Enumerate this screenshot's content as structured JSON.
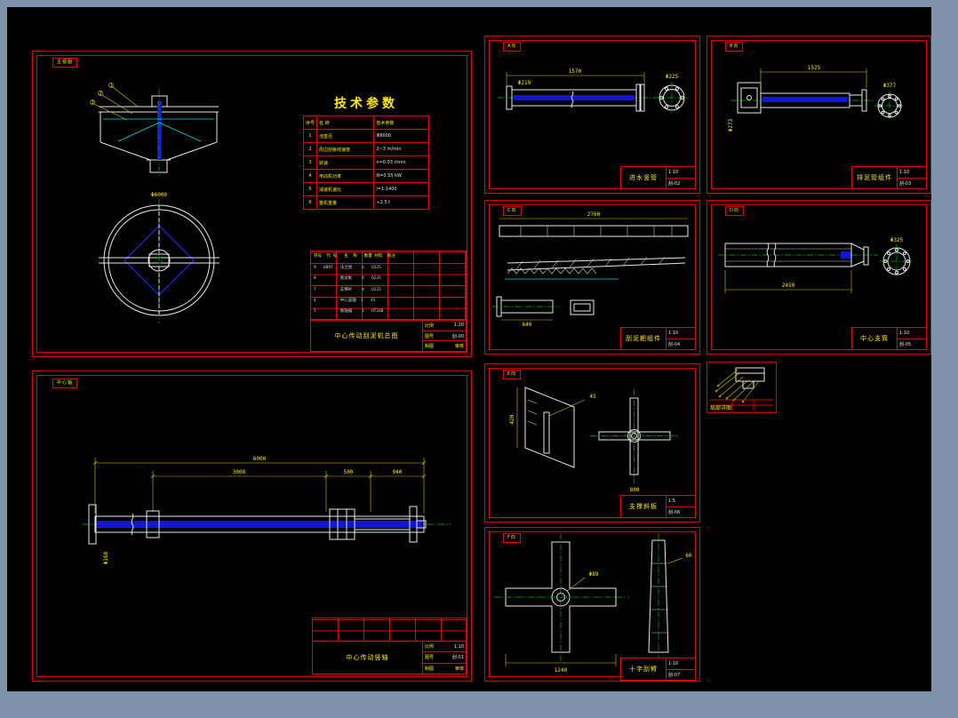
{
  "colors": {
    "bg": "#7e93a9",
    "paper": "#000000",
    "border": "#e60000",
    "dim_text": "#ffe900",
    "line_white": "#e8e8e8",
    "line_cyan": "#00dede",
    "line_green": "#00b400",
    "fill_blue": "#1414d6"
  },
  "tb": {
    "scale_label": "比例",
    "no_label": "图号",
    "drawn_label": "制图",
    "checked_label": "审核"
  },
  "tech_table": {
    "title": "技术参数",
    "header": [
      "序号",
      "名  称",
      "技术参数"
    ],
    "rows": [
      [
        "1",
        "池直径",
        "Φ6000"
      ],
      [
        "2",
        "周边刮板线速度",
        "2~3 m/min"
      ],
      [
        "3",
        "转速",
        "n=0.03 r/min"
      ],
      [
        "4",
        "电动机功率",
        "N=0.55 kW"
      ],
      [
        "5",
        "减速机速比",
        "i=1:1400"
      ],
      [
        "6",
        "整机重量",
        "≈2.5 t"
      ]
    ]
  },
  "bom": {
    "header": "序号  代 号   名  称   数量 材料  备注",
    "rows": [
      "9   GB97   法兰盘    2   Q235",
      "8          刮泥板    4   Q235",
      "7          支撑杆    4   Q235",
      "6          中心竖轴  1   45",
      "5          联轴器    1   HT200"
    ]
  },
  "sheets": {
    "a": {
      "tag": "主视图",
      "titleblock": {
        "name": "中心传动刮泥机总图",
        "scale": "1:20",
        "no": "刮-00"
      }
    },
    "b": {
      "tag": "中心轴",
      "titleblock": {
        "name": "中心传动竖轴",
        "scale": "1:10",
        "no": "刮-01"
      }
    },
    "c": {
      "tag": "A向",
      "titleblock": {
        "name": "进水竖管",
        "scale": "1:10",
        "no": "刮-02"
      }
    },
    "d": {
      "tag": "B向",
      "titleblock": {
        "name": "排泥管组件",
        "scale": "1:10",
        "no": "刮-03"
      }
    },
    "e": {
      "tag": "C向",
      "titleblock": {
        "name": "刮泥耙组件",
        "scale": "1:10",
        "no": "刮-04"
      }
    },
    "f": {
      "tag": "D向",
      "titleblock": {
        "name": "中心支筒",
        "scale": "1:10",
        "no": "刮-05"
      }
    },
    "g": {
      "tag": "E向",
      "titleblock": {
        "name": "支撑斜板",
        "scale": "1:5",
        "no": "刮-06"
      }
    },
    "h": {
      "tag": "详图",
      "titleblock": {
        "name": "局部详图"
      }
    },
    "i": {
      "tag": "F向",
      "titleblock": {
        "name": "十字刮臂",
        "scale": "1:10",
        "no": "刮-07"
      }
    }
  },
  "callouts": {
    "a": [
      "1",
      "2",
      "3"
    ]
  },
  "dims": {
    "a": {
      "d1": "Φ6000"
    },
    "b": {
      "d1": "6000",
      "d2": "3008",
      "d3": "500",
      "d4": "940",
      "d5": "Φ168"
    },
    "c": {
      "d1": "1570",
      "d2": "Φ225",
      "d3": "Φ219"
    },
    "d": {
      "d1": "1525",
      "d2": "Φ273",
      "d3": "Φ377"
    },
    "e": {
      "d1": "2760",
      "d2": "640"
    },
    "f": {
      "d1": "2450",
      "d2": "Φ325"
    },
    "g": {
      "d1": "420",
      "d2": "45",
      "d3": "800"
    },
    "i": {
      "d1": "1240",
      "d2": "Φ89",
      "d3": "60"
    }
  }
}
